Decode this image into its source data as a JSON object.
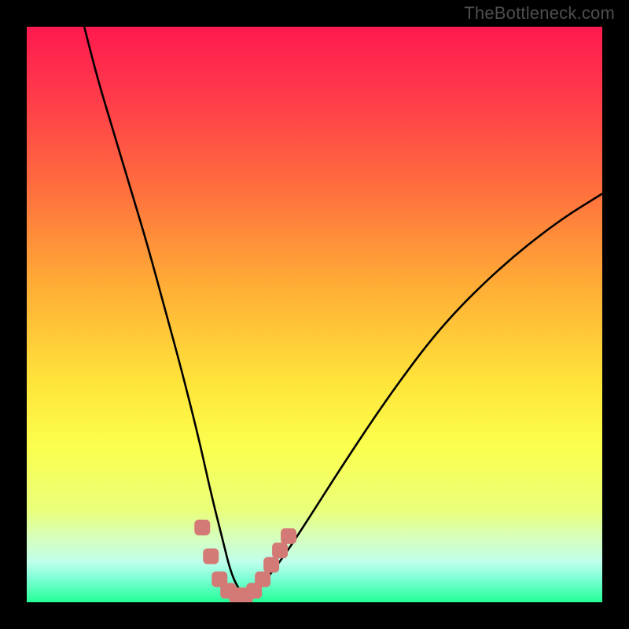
{
  "watermark": "TheBottleneck.com",
  "colors": {
    "black": "#000000",
    "curve_stroke": "#000000",
    "marker_fill": "#d37a76",
    "marker_stroke": "#a8514e",
    "gradient_stops": [
      {
        "offset": "0%",
        "color": "#ff1a4f"
      },
      {
        "offset": "12%",
        "color": "#ff3a4a"
      },
      {
        "offset": "28%",
        "color": "#ff6e3e"
      },
      {
        "offset": "45%",
        "color": "#ffad36"
      },
      {
        "offset": "62%",
        "color": "#ffe53a"
      },
      {
        "offset": "73%",
        "color": "#fbff4e"
      },
      {
        "offset": "84%",
        "color": "#eaff7a"
      },
      {
        "offset": "89%",
        "color": "#d5ffbf"
      },
      {
        "offset": "93%",
        "color": "#bfffec"
      },
      {
        "offset": "96%",
        "color": "#7affd4"
      },
      {
        "offset": "100%",
        "color": "#23ff96"
      }
    ]
  },
  "chart_data": {
    "type": "line",
    "title": "",
    "xlabel": "",
    "ylabel": "",
    "xlim": [
      0,
      100
    ],
    "ylim": [
      0,
      100
    ],
    "series": [
      {
        "name": "bottleneck-curve",
        "x": [
          10,
          12,
          15,
          18,
          21,
          24,
          27,
          30,
          32,
          34,
          35.5,
          37,
          38,
          40,
          44,
          48,
          55,
          63,
          72,
          82,
          92,
          100
        ],
        "values": [
          100,
          92,
          82,
          72,
          62,
          51,
          40,
          28,
          19,
          11,
          5,
          2,
          1,
          2,
          7,
          13,
          24,
          36,
          48,
          58,
          66,
          71
        ]
      }
    ],
    "markers": {
      "name": "highlighted-points",
      "x": [
        30.5,
        32.0,
        33.5,
        35.0,
        36.5,
        38.0,
        39.5,
        41.0,
        42.5,
        44.0,
        45.5
      ],
      "values": [
        13.0,
        8.0,
        4.0,
        2.0,
        1.2,
        1.2,
        2.0,
        4.0,
        6.5,
        9.0,
        11.5
      ]
    }
  }
}
